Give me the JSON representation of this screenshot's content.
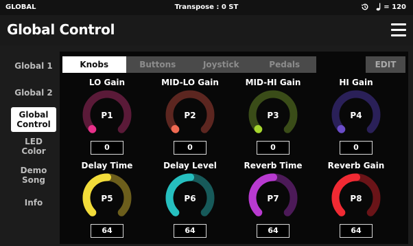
{
  "status": {
    "mode": "GLOBAL",
    "transpose": "Transpose : 0 ST",
    "tempo": "= 120"
  },
  "header": {
    "title": "Global Control"
  },
  "sidebar": {
    "items": [
      {
        "label": "Global 1"
      },
      {
        "label": "Global 2"
      },
      {
        "label": "Global Control"
      },
      {
        "label": "LED Color"
      },
      {
        "label": "Demo Song"
      },
      {
        "label": "Info"
      }
    ]
  },
  "tabs": [
    {
      "label": "Knobs"
    },
    {
      "label": "Buttons"
    },
    {
      "label": "Joystick"
    },
    {
      "label": "Pedals"
    }
  ],
  "edit_label": "EDIT",
  "knobs": [
    {
      "name": "LO Gain",
      "param": "P1",
      "value": "0",
      "color": "#e8308a",
      "track": "#5a1a38"
    },
    {
      "name": "MID-LO Gain",
      "param": "P2",
      "value": "0",
      "color": "#f06a52",
      "track": "#5c2620"
    },
    {
      "name": "MID-HI Gain",
      "param": "P3",
      "value": "0",
      "color": "#a6d62e",
      "track": "#3a4c18"
    },
    {
      "name": "HI Gain",
      "param": "P4",
      "value": "0",
      "color": "#6a4cc8",
      "track": "#2a2058"
    },
    {
      "name": "Delay Time",
      "param": "P5",
      "value": "64",
      "color": "#f2dc3a",
      "track": "#6c5e1c"
    },
    {
      "name": "Delay Level",
      "param": "P6",
      "value": "64",
      "color": "#26bfbf",
      "track": "#175a5a"
    },
    {
      "name": "Reverb Time",
      "param": "P7",
      "value": "64",
      "color": "#b83ad0",
      "track": "#4c1a58"
    },
    {
      "name": "Reverb Gain",
      "param": "P8",
      "value": "64",
      "color": "#f02a33",
      "track": "#6a1418"
    }
  ]
}
